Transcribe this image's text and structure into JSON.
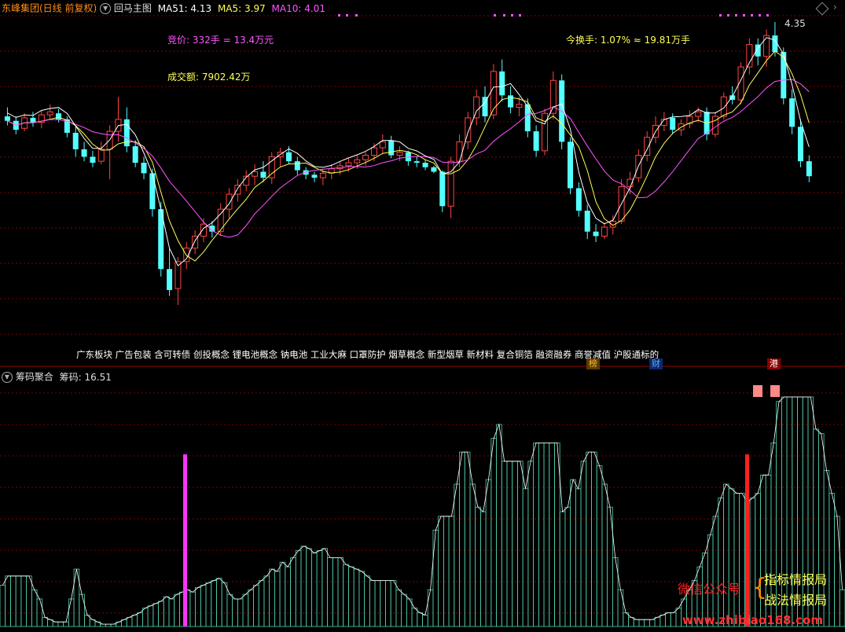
{
  "header": {
    "stock_name": "东峰集团(日线 前复权)",
    "indicator_name": "回马主图",
    "ma51_label": "MA51: 4.13",
    "ma5_label": "MA5: 3.97",
    "ma10_label": "MA10: 4.01"
  },
  "main_chart": {
    "bid_info": "竞价: 332手 = 13.4万元",
    "turnover_amount": "成交额: 7902.42万",
    "turnover_rate": "今换手: 1.07% ≈ 19.81万手",
    "high_price_marker": "4.35",
    "concepts": "广东板块 广告包装 含可转债 创投概念 锂电池概念 钠电池 工业大麻 口罩防护 烟草概念 新型烟草 新材料 复合铜箔 融资融券 商誉减值 沪股通标的"
  },
  "badges": {
    "bang": "榜",
    "cai": "财",
    "gang": "港"
  },
  "sub_chart": {
    "title": "筹码聚合",
    "value_label": "筹码: 16.51"
  },
  "watermark": {
    "wechat": "微信公众号",
    "brand1": "指标情报局",
    "brand2": "战法情报局",
    "url": "www.zhibiao168.com"
  },
  "colors": {
    "up_candle": "#ff4444",
    "down_candle": "#54ffff",
    "ma51": "#ffffff",
    "ma5": "#ffff55",
    "ma10": "#ff55ff",
    "grid": "#7f0000",
    "chip_histogram_edge": "#50d0b0",
    "magenta_signal": "#ff33ff",
    "red_signal": "#ff2020"
  },
  "chart_data": {
    "type": "candlestick",
    "ohlc": [
      [
        3.72,
        3.78,
        3.66,
        3.69
      ],
      [
        3.69,
        3.72,
        3.6,
        3.63
      ],
      [
        3.64,
        3.74,
        3.62,
        3.71
      ],
      [
        3.71,
        3.75,
        3.65,
        3.68
      ],
      [
        3.68,
        3.76,
        3.64,
        3.73
      ],
      [
        3.73,
        3.8,
        3.7,
        3.75
      ],
      [
        3.74,
        3.77,
        3.68,
        3.7
      ],
      [
        3.7,
        3.72,
        3.58,
        3.61
      ],
      [
        3.61,
        3.66,
        3.45,
        3.5
      ],
      [
        3.5,
        3.55,
        3.42,
        3.45
      ],
      [
        3.45,
        3.49,
        3.38,
        3.41
      ],
      [
        3.42,
        3.55,
        3.4,
        3.5
      ],
      [
        3.5,
        3.66,
        3.3,
        3.62
      ],
      [
        3.62,
        3.85,
        3.55,
        3.7
      ],
      [
        3.7,
        3.78,
        3.48,
        3.52
      ],
      [
        3.52,
        3.56,
        3.38,
        3.41
      ],
      [
        3.41,
        3.45,
        3.3,
        3.34
      ],
      [
        3.34,
        3.37,
        3.05,
        3.1
      ],
      [
        3.1,
        3.15,
        2.65,
        2.7
      ],
      [
        2.7,
        2.84,
        2.52,
        2.56
      ],
      [
        2.57,
        2.78,
        2.46,
        2.75
      ],
      [
        2.75,
        2.88,
        2.7,
        2.84
      ],
      [
        2.84,
        2.96,
        2.8,
        2.92
      ],
      [
        2.92,
        3.04,
        2.88,
        3.0
      ],
      [
        2.99,
        3.02,
        2.91,
        2.95
      ],
      [
        2.95,
        3.14,
        2.92,
        3.1
      ],
      [
        3.1,
        3.24,
        3.04,
        3.2
      ],
      [
        3.2,
        3.3,
        3.15,
        3.26
      ],
      [
        3.26,
        3.36,
        3.22,
        3.32
      ],
      [
        3.32,
        3.4,
        3.26,
        3.35
      ],
      [
        3.35,
        3.42,
        3.28,
        3.31
      ],
      [
        3.31,
        3.48,
        3.27,
        3.45
      ],
      [
        3.45,
        3.51,
        3.38,
        3.48
      ],
      [
        3.48,
        3.52,
        3.4,
        3.42
      ],
      [
        3.42,
        3.45,
        3.33,
        3.36
      ],
      [
        3.36,
        3.38,
        3.3,
        3.33
      ],
      [
        3.33,
        3.35,
        3.28,
        3.31
      ],
      [
        3.31,
        3.37,
        3.26,
        3.34
      ],
      [
        3.34,
        3.4,
        3.3,
        3.37
      ],
      [
        3.37,
        3.42,
        3.33,
        3.39
      ],
      [
        3.39,
        3.44,
        3.35,
        3.41
      ],
      [
        3.41,
        3.46,
        3.37,
        3.43
      ],
      [
        3.43,
        3.48,
        3.39,
        3.46
      ],
      [
        3.46,
        3.54,
        3.42,
        3.51
      ],
      [
        3.51,
        3.6,
        3.47,
        3.55
      ],
      [
        3.56,
        3.59,
        3.44,
        3.46
      ],
      [
        3.46,
        3.52,
        3.42,
        3.48
      ],
      [
        3.48,
        3.49,
        3.39,
        3.42
      ],
      [
        3.42,
        3.45,
        3.38,
        3.41
      ],
      [
        3.41,
        3.43,
        3.36,
        3.38
      ],
      [
        3.38,
        3.39,
        3.34,
        3.35
      ],
      [
        3.35,
        3.36,
        3.08,
        3.12
      ],
      [
        3.12,
        3.45,
        3.04,
        3.42
      ],
      [
        3.42,
        3.6,
        3.38,
        3.55
      ],
      [
        3.55,
        3.75,
        3.5,
        3.71
      ],
      [
        3.71,
        3.9,
        3.66,
        3.85
      ],
      [
        3.85,
        3.92,
        3.68,
        3.72
      ],
      [
        3.73,
        4.07,
        3.7,
        4.02
      ],
      [
        4.02,
        4.1,
        3.82,
        3.86
      ],
      [
        3.86,
        3.92,
        3.74,
        3.78
      ],
      [
        3.78,
        3.85,
        3.72,
        3.8
      ],
      [
        3.8,
        3.84,
        3.58,
        3.62
      ],
      [
        3.62,
        3.66,
        3.45,
        3.49
      ],
      [
        3.49,
        3.77,
        3.46,
        3.74
      ],
      [
        3.74,
        4.02,
        3.7,
        3.96
      ],
      [
        3.96,
        4.0,
        3.5,
        3.55
      ],
      [
        3.55,
        3.58,
        3.2,
        3.24
      ],
      [
        3.24,
        3.28,
        3.05,
        3.09
      ],
      [
        3.09,
        3.13,
        2.9,
        2.95
      ],
      [
        2.95,
        3.0,
        2.88,
        2.92
      ],
      [
        2.92,
        3.01,
        2.9,
        2.98
      ],
      [
        2.98,
        3.06,
        2.93,
        3.02
      ],
      [
        3.02,
        3.3,
        3.0,
        3.25
      ],
      [
        3.25,
        3.35,
        3.2,
        3.3
      ],
      [
        3.31,
        3.5,
        3.28,
        3.46
      ],
      [
        3.46,
        3.62,
        3.42,
        3.58
      ],
      [
        3.58,
        3.72,
        3.54,
        3.66
      ],
      [
        3.66,
        3.75,
        3.62,
        3.7
      ],
      [
        3.71,
        3.74,
        3.6,
        3.63
      ],
      [
        3.63,
        3.7,
        3.59,
        3.67
      ],
      [
        3.67,
        3.76,
        3.64,
        3.72
      ],
      [
        3.72,
        3.78,
        3.68,
        3.75
      ],
      [
        3.75,
        3.78,
        3.56,
        3.6
      ],
      [
        3.6,
        3.75,
        3.58,
        3.72
      ],
      [
        3.72,
        3.88,
        3.7,
        3.85
      ],
      [
        3.86,
        3.92,
        3.8,
        3.83
      ],
      [
        3.83,
        4.08,
        3.8,
        4.05
      ],
      [
        4.05,
        4.24,
        4.0,
        4.2
      ],
      [
        4.2,
        4.24,
        4.06,
        4.12
      ],
      [
        4.12,
        4.3,
        4.05,
        4.26
      ],
      [
        4.26,
        4.35,
        4.12,
        4.15
      ],
      [
        4.15,
        4.18,
        3.8,
        3.84
      ],
      [
        3.84,
        3.9,
        3.6,
        3.65
      ],
      [
        3.65,
        3.7,
        3.38,
        3.42
      ],
      [
        3.42,
        3.46,
        3.28,
        3.32
      ]
    ],
    "chip_histogram": [
      0.18,
      0.22,
      0.22,
      0.22,
      0.22,
      0.22,
      0.16,
      0.12,
      0.04,
      0.03,
      0.02,
      0.02,
      0.02,
      0.12,
      0.25,
      0.14,
      0.05,
      0.03,
      0.02,
      0.01,
      0.01,
      0.01,
      0.02,
      0.03,
      0.04,
      0.05,
      0.06,
      0.08,
      0.09,
      0.1,
      0.11,
      0.13,
      0.12,
      0.14,
      0.15,
      0.16,
      0.15,
      0.17,
      0.18,
      0.19,
      0.2,
      0.21,
      0.19,
      0.14,
      0.12,
      0.12,
      0.14,
      0.16,
      0.18,
      0.2,
      0.22,
      0.25,
      0.24,
      0.28,
      0.26,
      0.3,
      0.33,
      0.35,
      0.34,
      0.32,
      0.33,
      0.34,
      0.3,
      0.3,
      0.3,
      0.27,
      0.26,
      0.25,
      0.24,
      0.22,
      0.2,
      0.2,
      0.2,
      0.2,
      0.2,
      0.16,
      0.14,
      0.12,
      0.08,
      0.06,
      0.05,
      0.16,
      0.42,
      0.48,
      0.48,
      0.48,
      0.62,
      0.76,
      0.76,
      0.62,
      0.52,
      0.5,
      0.64,
      0.82,
      0.88,
      0.72,
      0.72,
      0.72,
      0.72,
      0.6,
      0.72,
      0.8,
      0.8,
      0.8,
      0.8,
      0.8,
      0.5,
      0.52,
      0.64,
      0.6,
      0.72,
      0.76,
      0.76,
      0.7,
      0.62,
      0.52,
      0.3,
      0.16,
      0.06,
      0.04,
      0.03,
      0.03,
      0.03,
      0.03,
      0.04,
      0.05,
      0.06,
      0.06,
      0.08,
      0.12,
      0.16,
      0.2,
      0.26,
      0.32,
      0.4,
      0.48,
      0.56,
      0.62,
      0.6,
      0.58,
      0.58,
      0.54,
      0.56,
      0.58,
      0.66,
      0.66,
      0.8,
      0.98,
      1.0,
      1.0,
      1.0,
      1.0,
      1.0,
      1.0,
      0.86,
      0.84,
      0.68,
      0.58,
      0.48,
      0.16
    ],
    "signals": [
      {
        "type": "magenta_bar",
        "index": 40
      },
      {
        "type": "red_bar",
        "index": 94
      }
    ]
  }
}
